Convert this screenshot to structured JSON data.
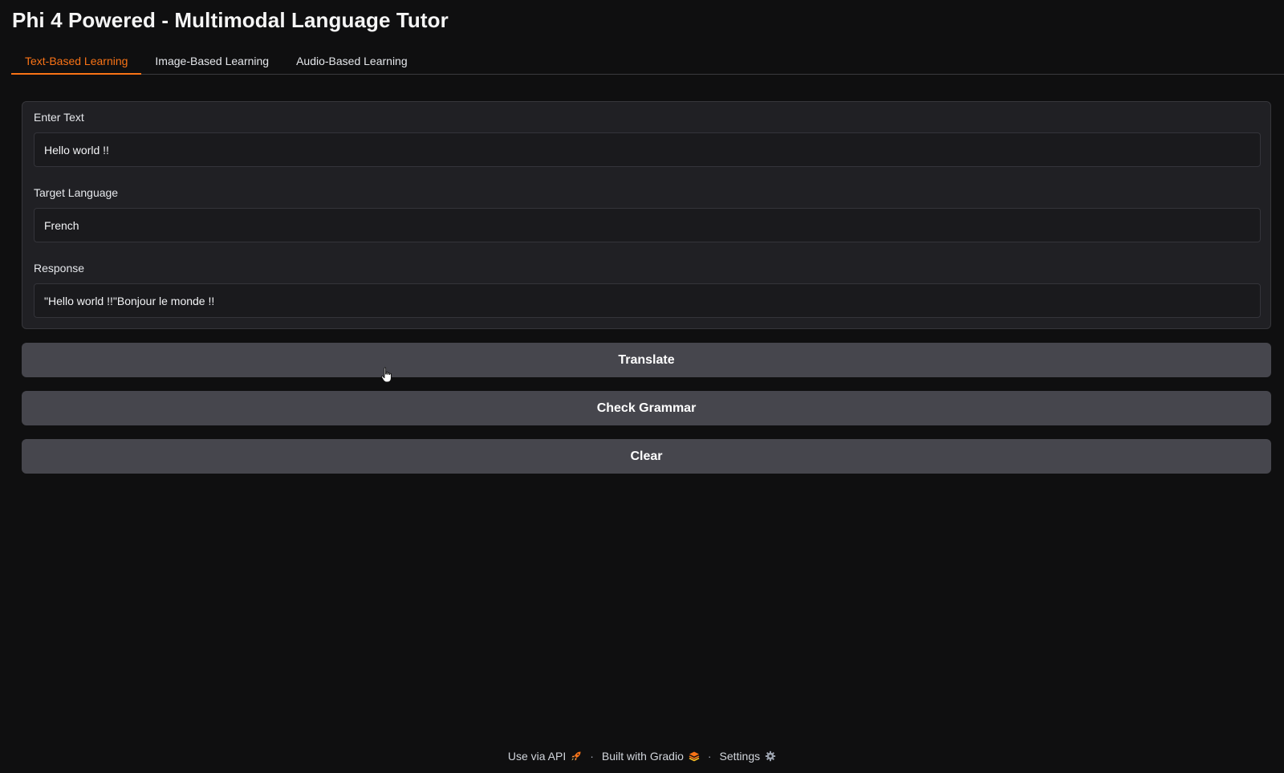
{
  "app": {
    "title": "Phi 4 Powered - Multimodal Language Tutor"
  },
  "tabs": [
    {
      "label": "Text-Based Learning",
      "active": true
    },
    {
      "label": "Image-Based Learning",
      "active": false
    },
    {
      "label": "Audio-Based Learning",
      "active": false
    }
  ],
  "form": {
    "enter_text": {
      "label": "Enter Text",
      "value": "Hello world !!"
    },
    "target_language": {
      "label": "Target Language",
      "value": "French"
    },
    "response": {
      "label": "Response",
      "value": "\"Hello world !!\"Bonjour le monde !!"
    }
  },
  "buttons": {
    "translate": "Translate",
    "check_grammar": "Check Grammar",
    "clear": "Clear"
  },
  "footer": {
    "use_api": "Use via API",
    "built_with": "Built with Gradio",
    "settings": "Settings",
    "separator": "·"
  },
  "icons": {
    "use_api": "rocket-icon",
    "built_with": "gradio-logo-icon",
    "settings": "gear-icon",
    "pointer": "hand-pointer-icon"
  },
  "colors": {
    "accent": "#f97316",
    "background": "#0f0f10",
    "panel": "#202024",
    "button": "#46464d"
  }
}
